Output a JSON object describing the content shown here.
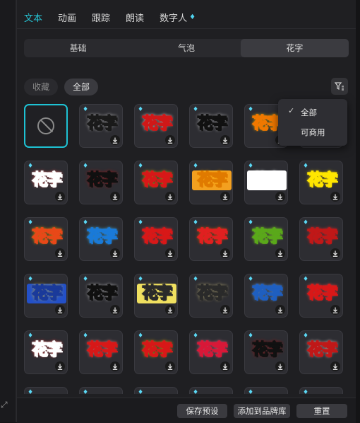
{
  "tabs": [
    {
      "label": "文本",
      "active": true
    },
    {
      "label": "动画",
      "active": false
    },
    {
      "label": "跟踪",
      "active": false
    },
    {
      "label": "朗读",
      "active": false
    },
    {
      "label": "数字人",
      "active": false,
      "icon": "diamond-icon"
    }
  ],
  "segments": [
    {
      "label": "基础",
      "active": false
    },
    {
      "label": "气泡",
      "active": false
    },
    {
      "label": "花字",
      "active": true
    }
  ],
  "chips": {
    "favorites": "收藏",
    "all": "全部"
  },
  "filter_menu": {
    "items": [
      {
        "label": "全部",
        "checked": true
      },
      {
        "label": "可商用",
        "checked": false
      }
    ]
  },
  "grid": {
    "effect_text": "花字",
    "none_icon": "no-effect-icon",
    "styles": [
      {
        "fill": "#ffe600",
        "stroke": "#1a1a1a",
        "glow": "#ffffff",
        "bg": ""
      },
      {
        "fill": "#ffffff",
        "stroke": "#d01818",
        "glow": "#ffffff",
        "bg": ""
      },
      {
        "fill": "#ffffff",
        "stroke": "#111111",
        "glow": "#ffffff",
        "bg": ""
      },
      {
        "fill": "#ffffff",
        "stroke": "#f07800",
        "glow": "#ffd200",
        "bg": ""
      },
      {
        "fill": "#ffffff",
        "stroke": "#d81818",
        "glow": "#ffcc00",
        "bg": ""
      },
      {
        "fill": "#d81818",
        "stroke": "#ffffff",
        "glow": "#ff5050",
        "bg": ""
      },
      {
        "fill": "#ffe600",
        "stroke": "#101010",
        "glow": "#d01818",
        "bg": ""
      },
      {
        "fill": "#ffffff",
        "stroke": "#d81818",
        "glow": "#ffcc00",
        "bg": ""
      },
      {
        "fill": "#ffffff",
        "stroke": "#e07a00",
        "glow": "#ffb000",
        "bg": "#f3a020"
      },
      {
        "fill": "#1f6fd0",
        "stroke": "#ffffff",
        "glow": "#ffffff",
        "bg": "#ffffff"
      },
      {
        "fill": "#ff4040",
        "stroke": "#ffe600",
        "glow": "#ffd700",
        "bg": ""
      },
      {
        "fill": "#ffffff",
        "stroke": "#e84818",
        "glow": "#ffcc00",
        "bg": ""
      },
      {
        "fill": "#ffffff",
        "stroke": "#1a7ad8",
        "glow": "#55d0ff",
        "bg": ""
      },
      {
        "fill": "#ffffff",
        "stroke": "#d81818",
        "glow": "#ff4040",
        "bg": ""
      },
      {
        "fill": "#ffffff",
        "stroke": "#e02020",
        "glow": "#ff6a00",
        "bg": ""
      },
      {
        "fill": "#ffffff",
        "stroke": "#5aa81a",
        "glow": "#a0e040",
        "bg": ""
      },
      {
        "fill": "#ffffff",
        "stroke": "#c01818",
        "glow": "#ff3030",
        "bg": ""
      },
      {
        "fill": "#ffffff",
        "stroke": "#1a3a9a",
        "glow": "#ffd200",
        "bg": "#2350c8"
      },
      {
        "fill": "#ffe600",
        "stroke": "#101010",
        "glow": "#ffffff",
        "bg": ""
      },
      {
        "fill": "#ffffff",
        "stroke": "#2a2a2a",
        "glow": "#f0e060",
        "bg": "#f0e060"
      },
      {
        "fill": "#ffffff",
        "stroke": "#2a2a2a",
        "glow": "#e8d890",
        "bg": ""
      },
      {
        "fill": "#ffffff",
        "stroke": "#1f5fc0",
        "glow": "#7ab8ff",
        "bg": ""
      },
      {
        "fill": "#ffffff",
        "stroke": "#d81818",
        "glow": "#ff5050",
        "bg": ""
      },
      {
        "fill": "#d81818",
        "stroke": "#ffffff",
        "glow": "#ff3030",
        "bg": ""
      },
      {
        "fill": "#ffffff",
        "stroke": "#d81818",
        "glow": "#ffa0a0",
        "bg": ""
      },
      {
        "fill": "#ffffff",
        "stroke": "#d81818",
        "glow": "#ffd200",
        "bg": ""
      },
      {
        "fill": "#ffffff",
        "stroke": "#d81838",
        "glow": "#ff80a0",
        "bg": ""
      },
      {
        "fill": "#ffffff",
        "stroke": "#111111",
        "glow": "#c01818",
        "bg": ""
      },
      {
        "fill": "#ffe600",
        "stroke": "#c01818",
        "glow": "#ffffff",
        "bg": ""
      },
      {
        "fill": "#ff5010",
        "stroke": "#ffd200",
        "glow": "#802000",
        "bg": ""
      }
    ],
    "partial_row": 6
  },
  "bottom": {
    "save_preset": "保存预设",
    "add_brand": "添加到品牌库",
    "reset": "重置"
  },
  "colors": {
    "accent": "#26c6d6",
    "gem": "#5ad8f5"
  }
}
